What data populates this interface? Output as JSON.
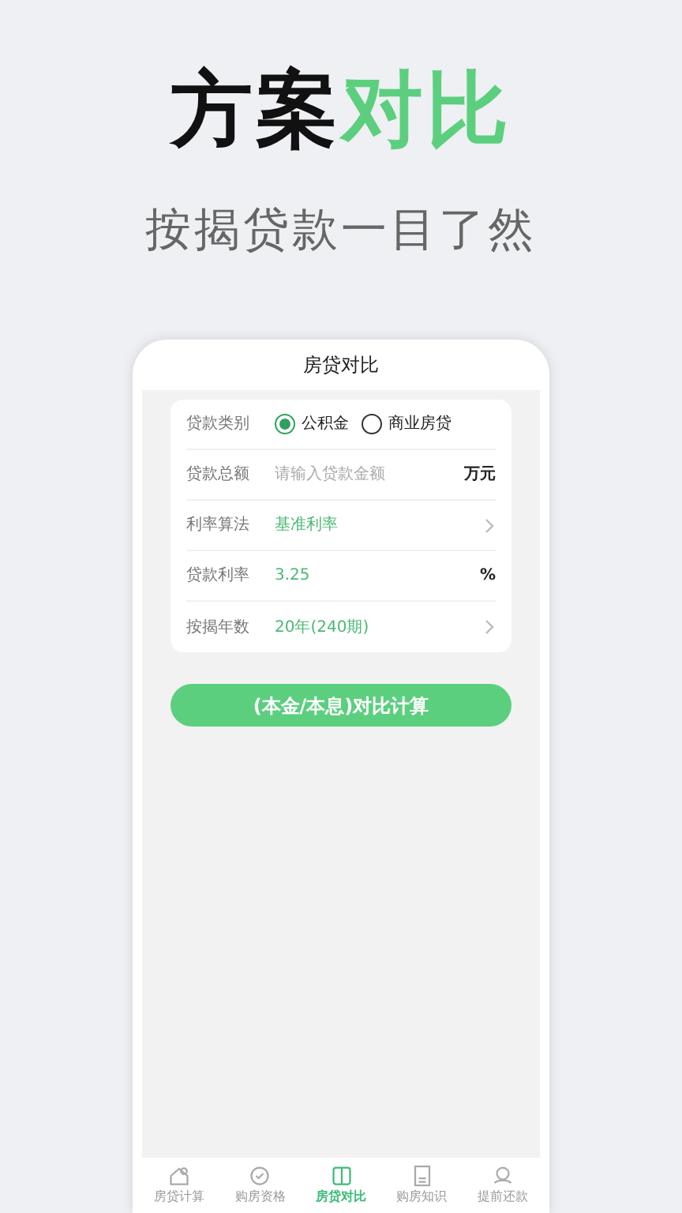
{
  "headline": [
    {
      "text": "方案",
      "accent": false
    },
    {
      "text": "对比",
      "accent": true
    }
  ],
  "subtitle": "按揭贷款一目了然",
  "screen": {
    "title": "房贷对比",
    "form": [
      {
        "kind": "radio",
        "label": "贷款类别",
        "options": [
          {
            "label": "公积金",
            "selected": true
          },
          {
            "label": "商业房贷",
            "selected": false
          }
        ]
      },
      {
        "kind": "input",
        "label": "贷款总额",
        "placeholder": "请输入贷款金额",
        "unit": "万元"
      },
      {
        "kind": "select",
        "label": "利率算法",
        "value": "基准利率"
      },
      {
        "kind": "value",
        "label": "贷款利率",
        "value": "3.25",
        "unit": "%"
      },
      {
        "kind": "select",
        "label": "按揭年数",
        "value": "20年(240期)"
      }
    ],
    "button": "(本金/本息)对比计算",
    "tabs": [
      {
        "label": "房贷计算",
        "selected": false
      },
      {
        "label": "购房资格",
        "selected": false
      },
      {
        "label": "房贷对比",
        "selected": true
      },
      {
        "label": "购房知识",
        "selected": false
      },
      {
        "label": "提前还款",
        "selected": false
      }
    ]
  }
}
